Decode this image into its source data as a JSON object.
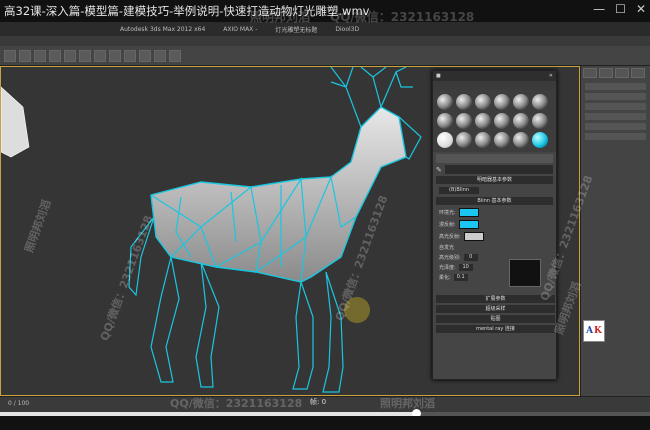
{
  "player": {
    "title": "高32课-深入篇-模型篇-建模技巧-举例说明-快速打造动物灯光雕塑.wmv",
    "minimize_icon": "minimize-icon",
    "maximize_icon": "maximize-icon",
    "close_icon": "close-icon"
  },
  "max_window": {
    "titles": [
      "Autodesk 3ds Max 2012 x64",
      "AXIO MAX -",
      "灯光雕塑无标题",
      "Diool3D"
    ]
  },
  "material_editor": {
    "rollout_basic": "明暗器基本参数",
    "shader": "(B)Blinn",
    "rollout_blinn": "Blinn 基本参数",
    "ambient_label": "环境光:",
    "diffuse_label": "漫反射:",
    "specular_label": "高光反射:",
    "self_illum_label": "自发光",
    "specular_level_label": "高光级别:",
    "glossiness_label": "光泽度:",
    "soften_label": "柔化:",
    "spin_values": [
      "0",
      "10",
      "0.1"
    ],
    "ext_params": "扩展参数",
    "supersampling": "超级采样",
    "maps": "贴图",
    "mental_ray": "mental ray 连接",
    "accent_cyan": "#1bc7f0"
  },
  "timeline": {
    "label": "0 / 100",
    "frame_box": "帧: 0"
  },
  "playback": {
    "progress": 0.64
  },
  "logo": {
    "left": "A",
    "right": "K"
  },
  "watermarks": [
    "照明邦刘滔",
    "QQ/微信：2321163128"
  ]
}
